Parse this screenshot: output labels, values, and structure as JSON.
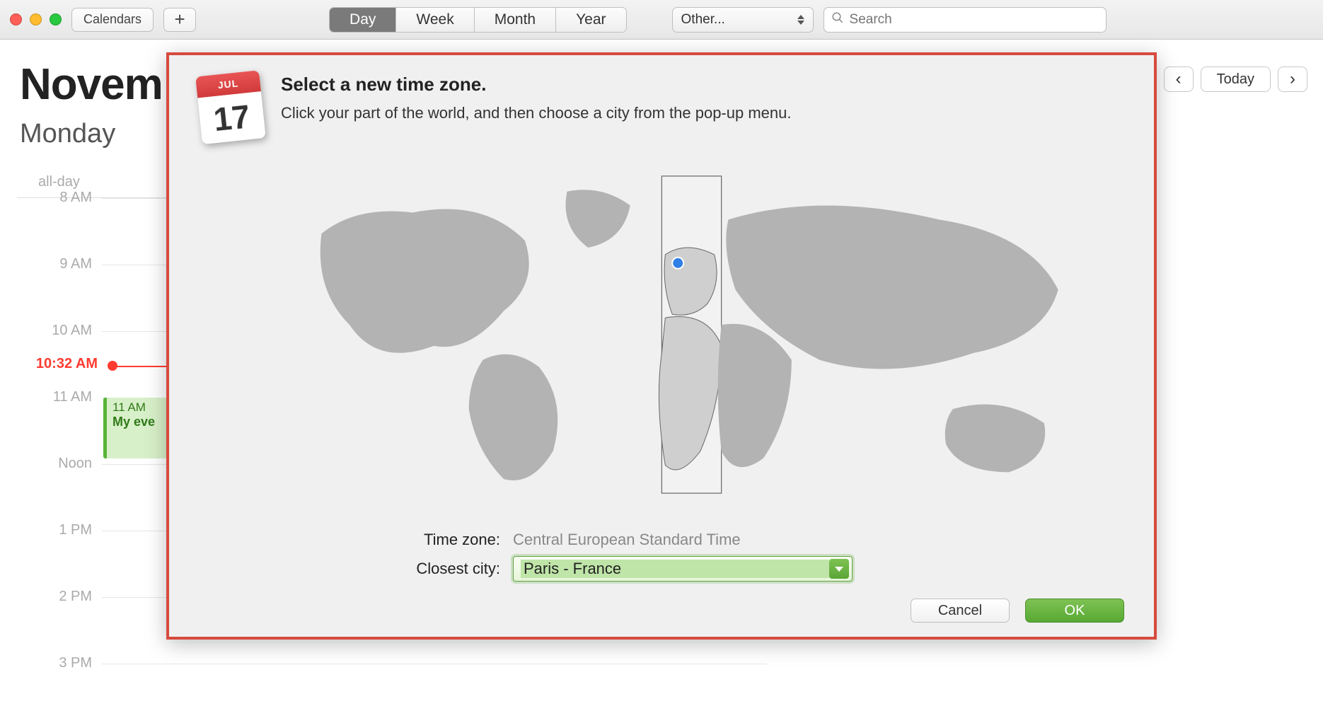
{
  "titlebar": {
    "calendars_label": "Calendars",
    "plus_label": "+",
    "view_tabs": {
      "day": "Day",
      "week": "Week",
      "month": "Month",
      "year": "Year",
      "active": "day"
    },
    "other_label": "Other...",
    "search_placeholder": "Search"
  },
  "nav": {
    "today_label": "Today"
  },
  "date": {
    "month_title_truncated": "Novem",
    "weekday": "Monday"
  },
  "day": {
    "allday_label": "all-day",
    "hours": [
      "8 AM",
      "9 AM",
      "10 AM",
      "11 AM",
      "Noon",
      "1 PM",
      "2 PM",
      "3 PM"
    ],
    "now_label": "10:32 AM",
    "event": {
      "time": "11 AM",
      "title_truncated": "My eve"
    }
  },
  "dialog": {
    "icon": {
      "month": "JUL",
      "day": "17"
    },
    "title": "Select a new time zone.",
    "subtitle": "Click your part of the world, and then choose a city from the pop-up menu.",
    "timezone_label": "Time zone:",
    "timezone_value": "Central European Standard Time",
    "city_label": "Closest city:",
    "city_value": "Paris - France",
    "cancel": "Cancel",
    "ok": "OK"
  }
}
